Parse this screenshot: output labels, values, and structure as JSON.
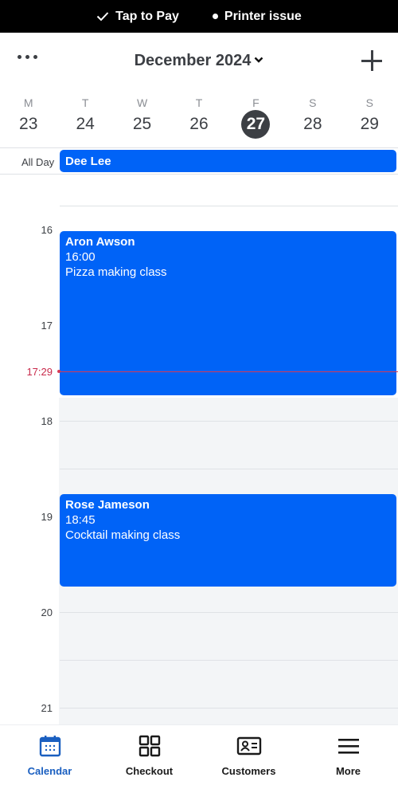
{
  "statusbar": {
    "items": [
      {
        "icon": "check-icon",
        "label": "Tap to Pay"
      },
      {
        "icon": "dot-icon",
        "label": "Printer issue"
      }
    ]
  },
  "header": {
    "title": "December 2024",
    "menu_icon": "more-dots-icon",
    "add_icon": "plus-icon",
    "dropdown_icon": "chevron-down-icon"
  },
  "week": {
    "days": [
      {
        "weekday": "M",
        "date": "23"
      },
      {
        "weekday": "T",
        "date": "24"
      },
      {
        "weekday": "W",
        "date": "25"
      },
      {
        "weekday": "T",
        "date": "26"
      },
      {
        "weekday": "F",
        "date": "27",
        "selected": true
      },
      {
        "weekday": "S",
        "date": "28"
      },
      {
        "weekday": "S",
        "date": "29"
      }
    ]
  },
  "allday": {
    "label": "All Day",
    "event": "Dee Lee"
  },
  "timeline": {
    "hours": [
      "16",
      "17",
      "18",
      "19",
      "20",
      "21"
    ],
    "now": "17:29",
    "events": [
      {
        "name": "Aron Awson",
        "time": "16:00",
        "description": "Pizza making class"
      },
      {
        "name": "Rose Jameson",
        "time": "18:45",
        "description": "Cocktail making class"
      }
    ]
  },
  "tabbar": {
    "tabs": [
      {
        "label": "Calendar",
        "icon": "calendar-icon",
        "active": true
      },
      {
        "label": "Checkout",
        "icon": "grid-icon"
      },
      {
        "label": "Customers",
        "icon": "id-card-icon"
      },
      {
        "label": "More",
        "icon": "menu-icon"
      }
    ]
  },
  "colors": {
    "event_blue": "#0063f7",
    "active_tab": "#1a5fc0",
    "now_red": "#c8294a",
    "text_dark": "#3c3f44"
  }
}
